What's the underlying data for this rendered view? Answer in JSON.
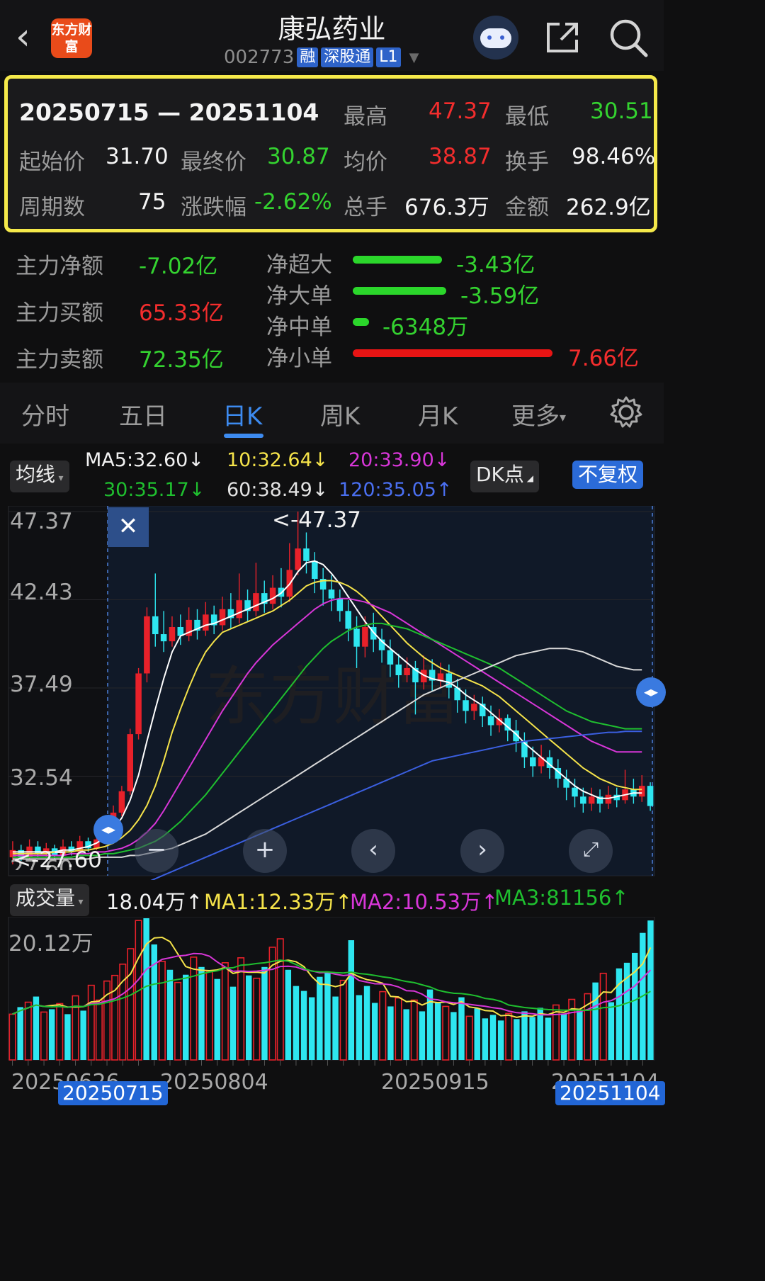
{
  "header": {
    "title": "康弘药业",
    "code": "002773",
    "tags": [
      "融",
      "深股通",
      "L1"
    ],
    "logo_text": "东方财富"
  },
  "summary": {
    "range": "20250715 — 20251104",
    "high_label": "最高",
    "high": "47.37",
    "low_label": "最低",
    "low": "30.51",
    "open_label": "起始价",
    "open": "31.70",
    "close_label": "最终价",
    "close": "30.87",
    "avg_label": "均价",
    "avg": "38.87",
    "turnover_label": "换手",
    "turnover": "98.46%",
    "periods_label": "周期数",
    "periods": "75",
    "change_label": "涨跌幅",
    "change": "-2.62%",
    "volume_label": "总手",
    "volume": "676.3万",
    "amount_label": "金额",
    "amount": "262.9亿"
  },
  "capital_flow": {
    "net_label": "主力净额",
    "net": "-7.02亿",
    "buy_label": "主力买额",
    "buy": "65.33亿",
    "sell_label": "主力卖额",
    "sell": "72.35亿",
    "items": [
      {
        "label": "净超大",
        "value": "-3.43亿",
        "amount": -3.43,
        "color": "#2bd62b"
      },
      {
        "label": "净大单",
        "value": "-3.59亿",
        "amount": -3.59,
        "color": "#2bd62b"
      },
      {
        "label": "净中单",
        "value": "-6348万",
        "amount": -0.6348,
        "color": "#2bd62b"
      },
      {
        "label": "净小单",
        "value": "7.66亿",
        "amount": 7.66,
        "color": "#e81414"
      }
    ]
  },
  "tabs": [
    "分时",
    "五日",
    "日K",
    "周K",
    "月K",
    "更多"
  ],
  "active_tab": "日K",
  "indicator_bar": {
    "ma_selector": "均线",
    "ma5": "MA5:32.60↓",
    "ma10": "10:32.64↓",
    "ma20": "20:33.90↓",
    "ma30": "30:35.17↓",
    "ma60": "60:38.49↓",
    "ma120": "120:35.05↑",
    "dk_button": "DK点",
    "adjust_button": "不复权"
  },
  "price_axis": [
    "47.37",
    "42.43",
    "37.49",
    "32.54",
    "27.60"
  ],
  "price_annotations": {
    "max": "<-47.37",
    "min": "<-27.60"
  },
  "volume_bar": {
    "selector": "成交量",
    "vol": "18.04万↑",
    "ma1": "MA1:12.33万↑",
    "ma2": "MA2:10.53万↑",
    "ma3": "MA3:81156↑",
    "axis_max": "20.12万"
  },
  "x_axis": [
    "20250626",
    "20250804",
    "20250915",
    "20251104"
  ],
  "range_markers": {
    "start": "20250715",
    "end": "20251104"
  },
  "colors": {
    "up": "#e8212a",
    "down": "#2ee6f0",
    "highlight": "#f5e94a",
    "accent": "#3d8bf0"
  },
  "chart_data": {
    "type": "candlestick",
    "ylim": [
      27.6,
      47.37
    ],
    "candles": [
      {
        "o": 28.0,
        "c": 28.4,
        "h": 28.9,
        "l": 27.6
      },
      {
        "o": 28.4,
        "c": 28.0,
        "h": 28.7,
        "l": 27.8
      },
      {
        "o": 28.0,
        "c": 28.6,
        "h": 29.0,
        "l": 27.9
      },
      {
        "o": 28.6,
        "c": 28.2,
        "h": 28.9,
        "l": 28.0
      },
      {
        "o": 28.2,
        "c": 28.5,
        "h": 28.8,
        "l": 28.0
      },
      {
        "o": 28.5,
        "c": 28.1,
        "h": 28.7,
        "l": 27.9
      },
      {
        "o": 28.1,
        "c": 28.6,
        "h": 29.0,
        "l": 28.0
      },
      {
        "o": 28.6,
        "c": 28.3,
        "h": 28.9,
        "l": 28.1
      },
      {
        "o": 28.3,
        "c": 28.9,
        "h": 29.2,
        "l": 28.2
      },
      {
        "o": 28.9,
        "c": 28.5,
        "h": 29.1,
        "l": 28.3
      },
      {
        "o": 28.5,
        "c": 29.0,
        "h": 29.3,
        "l": 28.4
      },
      {
        "o": 29.0,
        "c": 29.6,
        "h": 30.0,
        "l": 28.8
      },
      {
        "o": 29.6,
        "c": 30.5,
        "h": 30.9,
        "l": 29.4
      },
      {
        "o": 30.5,
        "c": 31.7,
        "h": 32.0,
        "l": 30.3
      },
      {
        "o": 31.7,
        "c": 34.9,
        "h": 35.2,
        "l": 31.5
      },
      {
        "o": 34.9,
        "c": 38.3,
        "h": 38.6,
        "l": 34.6
      },
      {
        "o": 38.3,
        "c": 41.5,
        "h": 42.0,
        "l": 37.8
      },
      {
        "o": 41.5,
        "c": 40.5,
        "h": 43.9,
        "l": 39.8
      },
      {
        "o": 40.5,
        "c": 40.1,
        "h": 41.8,
        "l": 39.5
      },
      {
        "o": 40.1,
        "c": 40.9,
        "h": 41.5,
        "l": 39.8
      },
      {
        "o": 40.9,
        "c": 40.4,
        "h": 41.6,
        "l": 39.9
      },
      {
        "o": 40.4,
        "c": 41.3,
        "h": 42.0,
        "l": 40.1
      },
      {
        "o": 41.3,
        "c": 40.7,
        "h": 41.9,
        "l": 40.2
      },
      {
        "o": 40.7,
        "c": 41.6,
        "h": 42.3,
        "l": 40.4
      },
      {
        "o": 41.6,
        "c": 41.0,
        "h": 42.1,
        "l": 40.5
      },
      {
        "o": 41.0,
        "c": 41.9,
        "h": 42.6,
        "l": 40.7
      },
      {
        "o": 41.9,
        "c": 41.4,
        "h": 42.8,
        "l": 40.8
      },
      {
        "o": 41.4,
        "c": 42.4,
        "h": 43.9,
        "l": 41.1
      },
      {
        "o": 42.4,
        "c": 41.8,
        "h": 43.0,
        "l": 41.2
      },
      {
        "o": 41.8,
        "c": 42.8,
        "h": 44.5,
        "l": 41.5
      },
      {
        "o": 42.8,
        "c": 42.2,
        "h": 43.5,
        "l": 41.7
      },
      {
        "o": 42.2,
        "c": 43.1,
        "h": 43.8,
        "l": 41.9
      },
      {
        "o": 43.1,
        "c": 42.6,
        "h": 44.2,
        "l": 42.0
      },
      {
        "o": 42.6,
        "c": 44.1,
        "h": 45.6,
        "l": 42.3
      },
      {
        "o": 44.1,
        "c": 45.3,
        "h": 47.37,
        "l": 43.8
      },
      {
        "o": 45.3,
        "c": 44.6,
        "h": 46.2,
        "l": 43.9
      },
      {
        "o": 44.6,
        "c": 43.6,
        "h": 45.1,
        "l": 42.8
      },
      {
        "o": 43.6,
        "c": 43.0,
        "h": 44.2,
        "l": 42.1
      },
      {
        "o": 43.0,
        "c": 42.5,
        "h": 43.8,
        "l": 41.8
      },
      {
        "o": 42.5,
        "c": 41.8,
        "h": 43.0,
        "l": 41.2
      },
      {
        "o": 41.8,
        "c": 40.8,
        "h": 42.4,
        "l": 40.1
      },
      {
        "o": 40.8,
        "c": 39.8,
        "h": 41.5,
        "l": 38.6
      },
      {
        "o": 39.8,
        "c": 40.9,
        "h": 41.5,
        "l": 39.2
      },
      {
        "o": 40.9,
        "c": 40.2,
        "h": 41.7,
        "l": 39.5
      },
      {
        "o": 40.2,
        "c": 39.6,
        "h": 40.8,
        "l": 38.9
      },
      {
        "o": 39.6,
        "c": 38.8,
        "h": 40.2,
        "l": 38.1
      },
      {
        "o": 38.8,
        "c": 38.2,
        "h": 39.4,
        "l": 37.5
      },
      {
        "o": 38.2,
        "c": 38.6,
        "h": 39.2,
        "l": 37.8
      },
      {
        "o": 38.6,
        "c": 37.8,
        "h": 39.0,
        "l": 36.0
      },
      {
        "o": 37.8,
        "c": 38.5,
        "h": 39.3,
        "l": 37.4
      },
      {
        "o": 38.5,
        "c": 37.9,
        "h": 39.1,
        "l": 37.3
      },
      {
        "o": 37.9,
        "c": 38.3,
        "h": 38.9,
        "l": 37.5
      },
      {
        "o": 38.3,
        "c": 37.5,
        "h": 38.8,
        "l": 36.9
      },
      {
        "o": 37.5,
        "c": 36.8,
        "h": 38.0,
        "l": 36.1
      },
      {
        "o": 36.8,
        "c": 36.2,
        "h": 37.4,
        "l": 35.5
      },
      {
        "o": 36.2,
        "c": 36.6,
        "h": 37.1,
        "l": 35.7
      },
      {
        "o": 36.6,
        "c": 35.9,
        "h": 37.0,
        "l": 35.3
      },
      {
        "o": 35.9,
        "c": 35.4,
        "h": 36.5,
        "l": 34.8
      },
      {
        "o": 35.4,
        "c": 35.8,
        "h": 36.3,
        "l": 35.0
      },
      {
        "o": 35.8,
        "c": 35.1,
        "h": 36.0,
        "l": 34.5
      },
      {
        "o": 35.1,
        "c": 34.5,
        "h": 35.7,
        "l": 33.9
      },
      {
        "o": 34.5,
        "c": 33.6,
        "h": 35.0,
        "l": 33.0
      },
      {
        "o": 33.6,
        "c": 33.1,
        "h": 34.2,
        "l": 32.5
      },
      {
        "o": 33.1,
        "c": 33.6,
        "h": 34.3,
        "l": 32.7
      },
      {
        "o": 33.6,
        "c": 33.0,
        "h": 34.0,
        "l": 32.4
      },
      {
        "o": 33.0,
        "c": 32.4,
        "h": 33.5,
        "l": 31.9
      },
      {
        "o": 32.4,
        "c": 31.9,
        "h": 32.9,
        "l": 31.2
      },
      {
        "o": 31.9,
        "c": 31.4,
        "h": 32.4,
        "l": 30.8
      },
      {
        "o": 31.4,
        "c": 31.0,
        "h": 31.9,
        "l": 30.5
      },
      {
        "o": 31.0,
        "c": 31.4,
        "h": 31.9,
        "l": 30.6
      },
      {
        "o": 31.4,
        "c": 31.0,
        "h": 31.8,
        "l": 30.51
      },
      {
        "o": 31.0,
        "c": 31.5,
        "h": 32.0,
        "l": 30.7
      },
      {
        "o": 31.5,
        "c": 31.2,
        "h": 31.9,
        "l": 30.8
      },
      {
        "o": 31.2,
        "c": 31.8,
        "h": 32.9,
        "l": 31.0
      },
      {
        "o": 31.8,
        "c": 31.4,
        "h": 32.4,
        "l": 31.0
      },
      {
        "o": 31.4,
        "c": 32.0,
        "h": 32.6,
        "l": 31.1
      },
      {
        "o": 32.0,
        "c": 30.87,
        "h": 32.2,
        "l": 30.6
      }
    ],
    "ma_series": [
      {
        "name": "MA5",
        "color": "#ffffff",
        "values": [
          28.3,
          28.3,
          28.3,
          28.3,
          28.3,
          28.3,
          28.4,
          28.4,
          28.5,
          28.6,
          28.8,
          29.1,
          29.6,
          30.2,
          31.2,
          32.6,
          34.5,
          36.3,
          38.0,
          39.5,
          40.4,
          40.6,
          40.8,
          41.0,
          41.1,
          41.3,
          41.5,
          41.7,
          41.9,
          42.1,
          42.3,
          42.5,
          42.8,
          43.3,
          44.0,
          44.5,
          44.6,
          44.4,
          43.9,
          43.3,
          42.6,
          41.9,
          41.2,
          40.6,
          40.1,
          39.7,
          39.3,
          38.9,
          38.5,
          38.2,
          38.0,
          37.9,
          37.8,
          37.5,
          37.1,
          36.8,
          36.5,
          36.1,
          35.7,
          35.3,
          34.9,
          34.4,
          34.0,
          33.6,
          33.2,
          32.8,
          32.4,
          32.0,
          31.7,
          31.5,
          31.3,
          31.3,
          31.4,
          31.5,
          31.6,
          31.6
        ]
      },
      {
        "name": "MA10",
        "color": "#f5e34a",
        "values": [
          28.2,
          28.2,
          28.2,
          28.2,
          28.2,
          28.3,
          28.3,
          28.3,
          28.4,
          28.4,
          28.5,
          28.6,
          28.8,
          29.1,
          29.5,
          30.1,
          30.9,
          32.0,
          33.4,
          35.0,
          36.3,
          37.5,
          38.6,
          39.5,
          40.1,
          40.6,
          40.8,
          41.0,
          41.2,
          41.4,
          41.6,
          41.8,
          42.1,
          42.4,
          42.8,
          43.2,
          43.4,
          43.5,
          43.5,
          43.4,
          43.2,
          42.9,
          42.5,
          42.0,
          41.5,
          41.0,
          40.5,
          40.0,
          39.6,
          39.2,
          38.9,
          38.6,
          38.4,
          38.2,
          38.0,
          37.8,
          37.6,
          37.3,
          37.0,
          36.6,
          36.2,
          35.8,
          35.4,
          35.0,
          34.6,
          34.2,
          33.8,
          33.4,
          33.0,
          32.7,
          32.4,
          32.2,
          32.0,
          31.9,
          31.8,
          31.8
        ]
      },
      {
        "name": "MA20",
        "color": "#d836d8",
        "values": [
          28.1,
          28.1,
          28.1,
          28.1,
          28.1,
          28.1,
          28.1,
          28.2,
          28.2,
          28.2,
          28.3,
          28.3,
          28.4,
          28.5,
          28.7,
          29.0,
          29.4,
          29.9,
          30.6,
          31.4,
          32.2,
          33.0,
          33.8,
          34.6,
          35.4,
          36.2,
          36.9,
          37.6,
          38.3,
          38.9,
          39.4,
          39.9,
          40.3,
          40.7,
          41.1,
          41.5,
          41.9,
          42.2,
          42.4,
          42.5,
          42.5,
          42.4,
          42.3,
          42.1,
          41.9,
          41.7,
          41.4,
          41.1,
          40.8,
          40.5,
          40.2,
          39.9,
          39.6,
          39.3,
          39.0,
          38.7,
          38.4,
          38.1,
          37.8,
          37.5,
          37.2,
          36.9,
          36.6,
          36.3,
          36.0,
          35.7,
          35.4,
          35.1,
          34.8,
          34.5,
          34.3,
          34.1,
          33.9,
          33.9,
          33.9,
          33.9
        ]
      },
      {
        "name": "MA30",
        "color": "#1fbf2f",
        "values": [
          28.0,
          28.0,
          28.0,
          28.0,
          28.0,
          28.0,
          28.0,
          28.0,
          28.1,
          28.1,
          28.1,
          28.2,
          28.2,
          28.3,
          28.4,
          28.5,
          28.7,
          28.9,
          29.2,
          29.6,
          30.0,
          30.5,
          31.0,
          31.5,
          32.1,
          32.7,
          33.3,
          33.9,
          34.5,
          35.1,
          35.7,
          36.3,
          36.9,
          37.5,
          38.1,
          38.7,
          39.2,
          39.7,
          40.1,
          40.4,
          40.7,
          40.9,
          41.0,
          41.1,
          41.1,
          41.0,
          40.9,
          40.8,
          40.6,
          40.4,
          40.2,
          40.0,
          39.8,
          39.6,
          39.4,
          39.2,
          39.0,
          38.8,
          38.6,
          38.3,
          38.0,
          37.7,
          37.4,
          37.1,
          36.8,
          36.5,
          36.2,
          36.0,
          35.8,
          35.6,
          35.5,
          35.4,
          35.3,
          35.2,
          35.2,
          35.2
        ]
      },
      {
        "name": "MA60",
        "color": "#d8d8d8",
        "values": [
          27.9,
          27.9,
          27.9,
          27.9,
          27.9,
          27.9,
          27.9,
          27.9,
          27.9,
          27.9,
          28.0,
          28.0,
          28.0,
          28.0,
          28.1,
          28.1,
          28.2,
          28.3,
          28.4,
          28.5,
          28.7,
          28.9,
          29.1,
          29.3,
          29.6,
          29.9,
          30.2,
          30.5,
          30.8,
          31.1,
          31.4,
          31.7,
          32.0,
          32.3,
          32.6,
          32.9,
          33.2,
          33.5,
          33.8,
          34.1,
          34.4,
          34.7,
          35.0,
          35.3,
          35.6,
          35.9,
          36.2,
          36.5,
          36.8,
          37.1,
          37.3,
          37.5,
          37.7,
          37.9,
          38.1,
          38.3,
          38.5,
          38.7,
          38.9,
          39.1,
          39.3,
          39.4,
          39.5,
          39.6,
          39.7,
          39.7,
          39.7,
          39.6,
          39.5,
          39.3,
          39.1,
          38.9,
          38.7,
          38.6,
          38.5,
          38.5
        ]
      },
      {
        "name": "MA120",
        "color": "#3b5fe0",
        "values": [
          25.0,
          25.1,
          25.2,
          25.3,
          25.4,
          25.5,
          25.6,
          25.7,
          25.8,
          25.9,
          26.0,
          26.1,
          26.2,
          26.3,
          26.4,
          26.5,
          26.6,
          26.8,
          27.0,
          27.2,
          27.4,
          27.6,
          27.8,
          28.0,
          28.2,
          28.4,
          28.6,
          28.8,
          29.0,
          29.2,
          29.4,
          29.6,
          29.8,
          30.0,
          30.2,
          30.4,
          30.6,
          30.8,
          31.0,
          31.2,
          31.4,
          31.6,
          31.8,
          32.0,
          32.2,
          32.4,
          32.6,
          32.8,
          33.0,
          33.2,
          33.4,
          33.5,
          33.6,
          33.7,
          33.8,
          33.9,
          34.0,
          34.1,
          34.2,
          34.3,
          34.4,
          34.5,
          34.55,
          34.6,
          34.65,
          34.7,
          34.75,
          34.8,
          34.85,
          34.9,
          34.95,
          35.0,
          35.0,
          35.05,
          35.05,
          35.05
        ]
      }
    ],
    "volumes": [
      6.5,
      7.5,
      8.2,
      9.0,
      6.8,
      7.2,
      8.0,
      6.5,
      9.1,
      7.0,
      10.6,
      8.5,
      11.2,
      12.0,
      13.6,
      15.8,
      19.8,
      21.0,
      16.4,
      14.0,
      12.8,
      11.0,
      12.1,
      14.6,
      13.2,
      12.5,
      11.5,
      13.8,
      10.4,
      14.5,
      12.0,
      11.6,
      13.2,
      16.0,
      17.2,
      12.8,
      10.5,
      9.8,
      8.9,
      11.8,
      12.5,
      9.0,
      11.3,
      17.0,
      9.2,
      10.5,
      8.1,
      9.7,
      7.6,
      8.8,
      7.2,
      8.5,
      6.9,
      10.0,
      8.1,
      7.6,
      6.8,
      8.9,
      6.2,
      7.3,
      5.9,
      6.4,
      5.6,
      6.6,
      5.8,
      6.9,
      6.1,
      7.4,
      6.0,
      7.8,
      6.5,
      8.6,
      7.0,
      9.4,
      11.0,
      12.3,
      8.2,
      13.0,
      13.8,
      15.2,
      18.04,
      19.8
    ],
    "volume_ylim": [
      0,
      20.12
    ],
    "volume_ma": [
      {
        "name": "MA1",
        "color": "#f5e34a"
      },
      {
        "name": "MA2",
        "color": "#d836d8"
      },
      {
        "name": "MA3",
        "color": "#1fbf2f"
      }
    ]
  }
}
